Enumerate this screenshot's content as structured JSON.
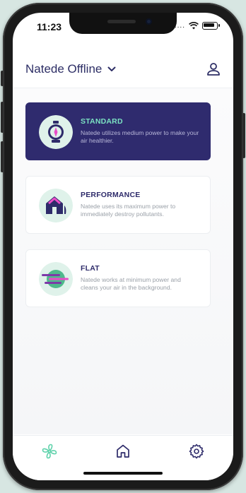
{
  "status_bar": {
    "time": "11:23",
    "signal": "....",
    "wifi_icon": "wifi-icon",
    "battery_icon": "battery-icon"
  },
  "header": {
    "device_name": "Natede Offline",
    "dropdown_icon": "chevron-down-icon",
    "profile_icon": "user-icon"
  },
  "modes": [
    {
      "title": "STANDARD",
      "description": "Natede utilizes medium power to make your air healthier.",
      "icon": "lamp-icon",
      "active": true
    },
    {
      "title": "PERFORMANCE",
      "description": "Natede uses its maximum power to immediately destroy pollutants.",
      "icon": "house-icon",
      "active": false
    },
    {
      "title": "FLAT",
      "description": "Natede works at minimum power and cleans your air in the background.",
      "icon": "wind-icon",
      "active": false
    }
  ],
  "tabbar": [
    {
      "name": "fan",
      "icon": "fan-icon",
      "color": "#5fd2ab"
    },
    {
      "name": "home",
      "icon": "home-icon",
      "color": "#2e2b6a"
    },
    {
      "name": "settings",
      "icon": "gear-icon",
      "color": "#2e2b6a"
    }
  ],
  "colors": {
    "primary": "#2e2b6a",
    "accent": "#7be2c2",
    "muted": "#9aa0a8"
  }
}
